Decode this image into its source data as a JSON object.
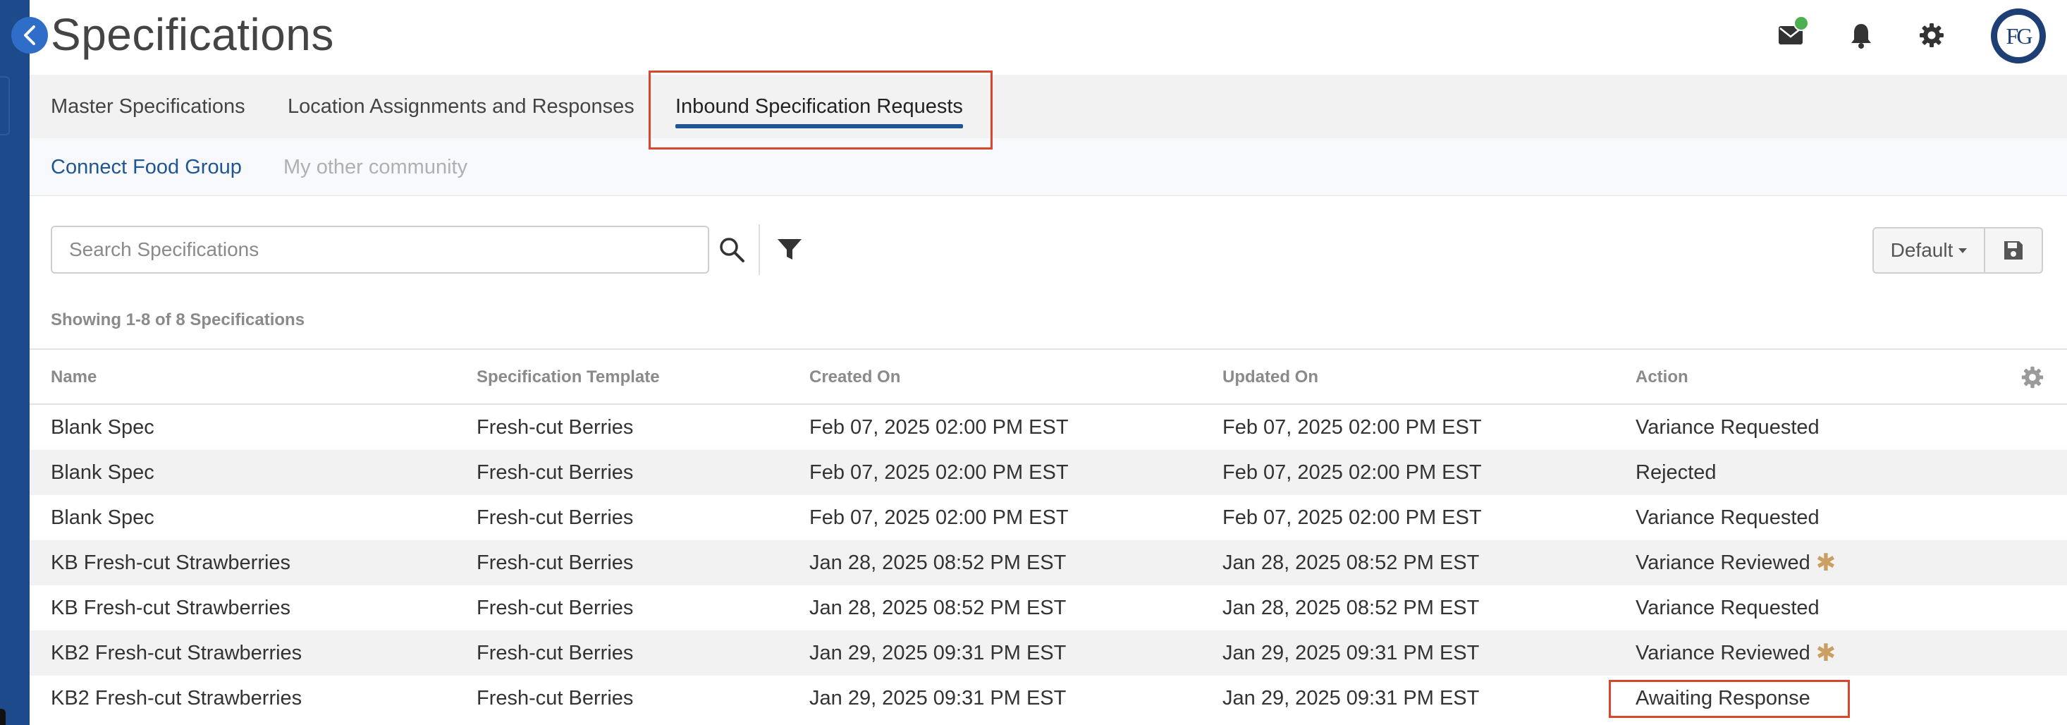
{
  "header": {
    "title": "Specifications"
  },
  "tabs": [
    {
      "label": "Master Specifications"
    },
    {
      "label": "Location Assignments and Responses"
    },
    {
      "label": "Inbound Specification Requests"
    }
  ],
  "subtabs": [
    {
      "label": "Connect Food Group"
    },
    {
      "label": "My other community"
    }
  ],
  "search": {
    "placeholder": "Search Specifications",
    "value": ""
  },
  "view": {
    "label": "Default"
  },
  "results": {
    "count_text": "Showing 1-8 of 8 Specifications"
  },
  "avatar": {
    "initials": "FG"
  },
  "colors": {
    "accent": "#1f5593",
    "highlight": "#d9462e",
    "sidebar": "#1d4a8a",
    "star": "#c9a062",
    "notification": "#4caf50"
  },
  "table": {
    "columns": [
      "Name",
      "Specification Template",
      "Created On",
      "Updated On",
      "Action"
    ],
    "rows": [
      {
        "name": "Blank Spec",
        "template": "Fresh-cut Berries",
        "created": "Feb 07, 2025 02:00 PM EST",
        "updated": "Feb 07, 2025 02:00 PM EST",
        "action": "Variance Requested",
        "star": ""
      },
      {
        "name": "Blank Spec",
        "template": "Fresh-cut Berries",
        "created": "Feb 07, 2025 02:00 PM EST",
        "updated": "Feb 07, 2025 02:00 PM EST",
        "action": "Rejected",
        "star": ""
      },
      {
        "name": "Blank Spec",
        "template": "Fresh-cut Berries",
        "created": "Feb 07, 2025 02:00 PM EST",
        "updated": "Feb 07, 2025 02:00 PM EST",
        "action": "Variance Requested",
        "star": ""
      },
      {
        "name": "KB Fresh-cut Strawberries",
        "template": "Fresh-cut Berries",
        "created": "Jan 28, 2025 08:52 PM EST",
        "updated": "Jan 28, 2025 08:52 PM EST",
        "action": "Variance Reviewed",
        "star": "✱"
      },
      {
        "name": "KB Fresh-cut Strawberries",
        "template": "Fresh-cut Berries",
        "created": "Jan 28, 2025 08:52 PM EST",
        "updated": "Jan 28, 2025 08:52 PM EST",
        "action": "Variance Requested",
        "star": ""
      },
      {
        "name": "KB2 Fresh-cut Strawberries",
        "template": "Fresh-cut Berries",
        "created": "Jan 29, 2025 09:31 PM EST",
        "updated": "Jan 29, 2025 09:31 PM EST",
        "action": "Variance Reviewed",
        "star": "✱"
      },
      {
        "name": "KB2 Fresh-cut Strawberries",
        "template": "Fresh-cut Berries",
        "created": "Jan 29, 2025 09:31 PM EST",
        "updated": "Jan 29, 2025 09:31 PM EST",
        "action": "Awaiting Response",
        "star": ""
      }
    ]
  }
}
